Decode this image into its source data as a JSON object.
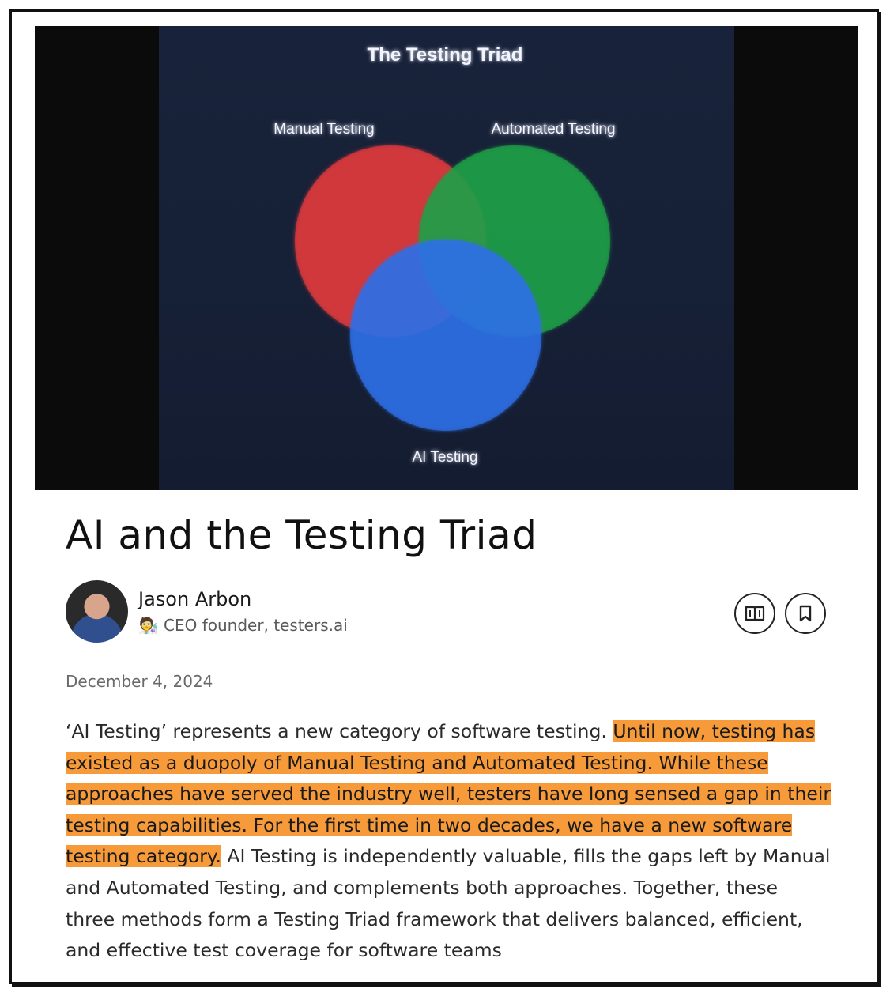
{
  "figure": {
    "title": "The Testing Triad",
    "labels": {
      "manual": "Manual Testing",
      "automated": "Automated Testing",
      "ai": "AI Testing"
    },
    "colors": {
      "manual": "#d8383c",
      "automated": "#1fa046",
      "ai": "#2e6fe6",
      "background": "#172036"
    }
  },
  "article": {
    "title": "AI and the Testing Triad",
    "author_name": "Jason Arbon",
    "author_subtitle": "CEO founder, testers.ai",
    "author_emoji": "🧑‍🔬",
    "date": "December 4, 2024",
    "body_plain_1": "‘AI Testing’ represents a new category of software testing. ",
    "body_highlight": "Until now, testing has existed as a duopoly of Manual Testing and Automated Testing. While these approaches have served the industry well, testers have long sensed a gap in their testing capabilities. For the first time in two decades, we have a new software testing category.",
    "body_plain_2": " AI Testing is independently valuable, fills the gaps left by Manual and Automated Testing, and complements both approaches. Together, these three methods form a Testing Triad framework that delivers balanced, efficient, and effective test coverage for software teams",
    "highlight_color": "#f79a3a"
  },
  "actions": {
    "read_icon": "open-book-icon",
    "save_icon": "bookmark-icon"
  }
}
